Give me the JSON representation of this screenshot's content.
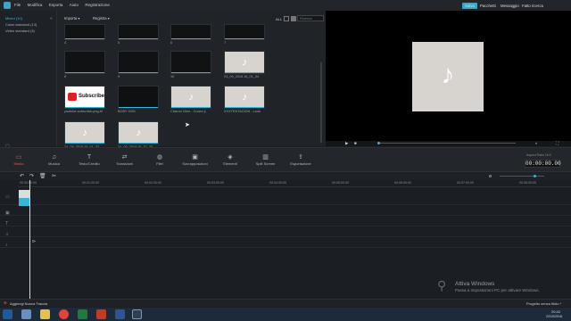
{
  "menu": [
    "File",
    "Modifica",
    "Esporta",
    "Aiuto",
    "Registrazione"
  ],
  "top_buttons": {
    "salva": "Salva",
    "pacchetti": "Pacchetti",
    "messaggio": "Messaggio",
    "feedback": "Fatto ricerca"
  },
  "sidebar": {
    "items": [
      {
        "label": "Mixed (10)",
        "active": true
      },
      {
        "label": "Colori standard (13)",
        "active": false
      },
      {
        "label": "Video standard (3)",
        "active": false
      }
    ]
  },
  "library_bar": {
    "importa": "Importa",
    "registra": "Registra",
    "all": "ALL",
    "search_placeholder": "Ricerca"
  },
  "thumbs": [
    {
      "label": "4",
      "style": "dark"
    },
    {
      "label": "5",
      "style": "dark"
    },
    {
      "label": "6",
      "style": "dark"
    },
    {
      "label": "7",
      "style": "dark"
    },
    {
      "label": "8",
      "style": "dark"
    },
    {
      "label": "9",
      "style": "dark"
    },
    {
      "label": "10",
      "style": "dark"
    },
    {
      "label": "23_09_2018 16_01_34",
      "style": "light"
    },
    {
      "label": "youtube-subscribe-png-bl",
      "style": "sub"
    },
    {
      "label": "BOBY 2001",
      "style": "dark2"
    },
    {
      "label": "Clairvoi Cline - Crown ji",
      "style": "light"
    },
    {
      "label": "XXXTENTACION - Look",
      "style": "light"
    },
    {
      "label": "24_09_2018 16_01_33",
      "style": "light"
    },
    {
      "label": "24_09_2018 16_37_33",
      "style": "light"
    }
  ],
  "tabs": [
    {
      "label": "Media",
      "active": true
    },
    {
      "label": "Musica"
    },
    {
      "label": "Testo/Credito"
    },
    {
      "label": "Transizioni"
    },
    {
      "label": "Filtri"
    },
    {
      "label": "Sovrapposizioni"
    },
    {
      "label": "Elementi"
    },
    {
      "label": "Split Screen"
    },
    {
      "label": "Esportazione"
    }
  ],
  "timecode": "00:00:00.00",
  "timecode_label": "Aspect Ratio 16:9",
  "ruler": [
    "00:00:00:00",
    "00:01:00:00",
    "00:02:00:00",
    "00:03:00:00",
    "00:04:00:00",
    "00:05:00:00",
    "00:06:00:00",
    "00:07:00:00",
    "00:08:00:00"
  ],
  "bottom": {
    "add_track": "Aggiungi Nuova Traccia",
    "project": "Progetto senza titolo *"
  },
  "watermark": {
    "title": "Attiva Windows",
    "sub": "Passa a Impostazioni PC per attivare Windows."
  },
  "clock": {
    "time": "20:42",
    "date": "22/10/2018"
  }
}
